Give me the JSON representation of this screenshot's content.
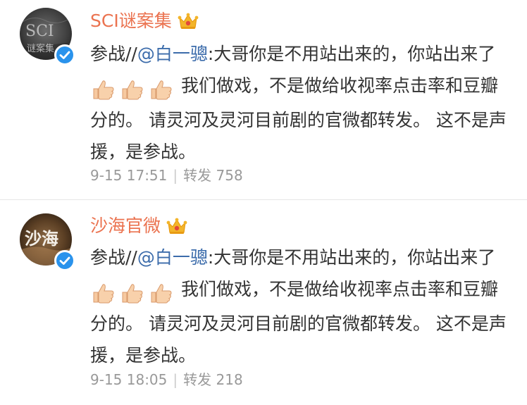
{
  "posts": [
    {
      "username": "SCI谜案集",
      "avatar_icon": "avatar-sci",
      "avatar_text": "SCI谜案集",
      "verified_icon": "verified-check-icon",
      "vip_icon": "crown-icon",
      "content": {
        "prefix": "参战//",
        "mention": "@白一骢",
        "text_before_emoji": ":大哥你是不用站出来的，你站出来了",
        "emoji_names": [
          "thumbs-up-icon",
          "thumbs-up-icon",
          "thumbs-up-icon"
        ],
        "text_after_emoji": "我们做戏，不是做给收视率点击率和豆瓣分的。 请灵河及灵河目前剧的官微都转发。 这不是声援，是参战。"
      },
      "time": "9-15 17:51",
      "separator": "|",
      "repost_label": "转发",
      "repost_count": "758"
    },
    {
      "username": "沙海官微",
      "avatar_icon": "avatar-shahai",
      "avatar_text": "沙海",
      "verified_icon": "verified-check-icon",
      "vip_icon": "crown-icon",
      "content": {
        "prefix": "参战//",
        "mention": "@白一骢",
        "text_before_emoji": ":大哥你是不用站出来的，你站出来了",
        "emoji_names": [
          "thumbs-up-icon",
          "thumbs-up-icon",
          "thumbs-up-icon"
        ],
        "text_after_emoji": "我们做戏，不是做给收视率点击率和豆瓣分的。 请灵河及灵河目前剧的官微都转发。 这不是声援，是参战。"
      },
      "time": "9-15 18:05",
      "separator": "|",
      "repost_label": "转发",
      "repost_count": "218"
    }
  ],
  "colors": {
    "username": "#eb7350",
    "mention": "#3c6cab",
    "text": "#333333",
    "meta": "#999999",
    "verified": "#2a93ec",
    "crown": "#f3b52a"
  }
}
